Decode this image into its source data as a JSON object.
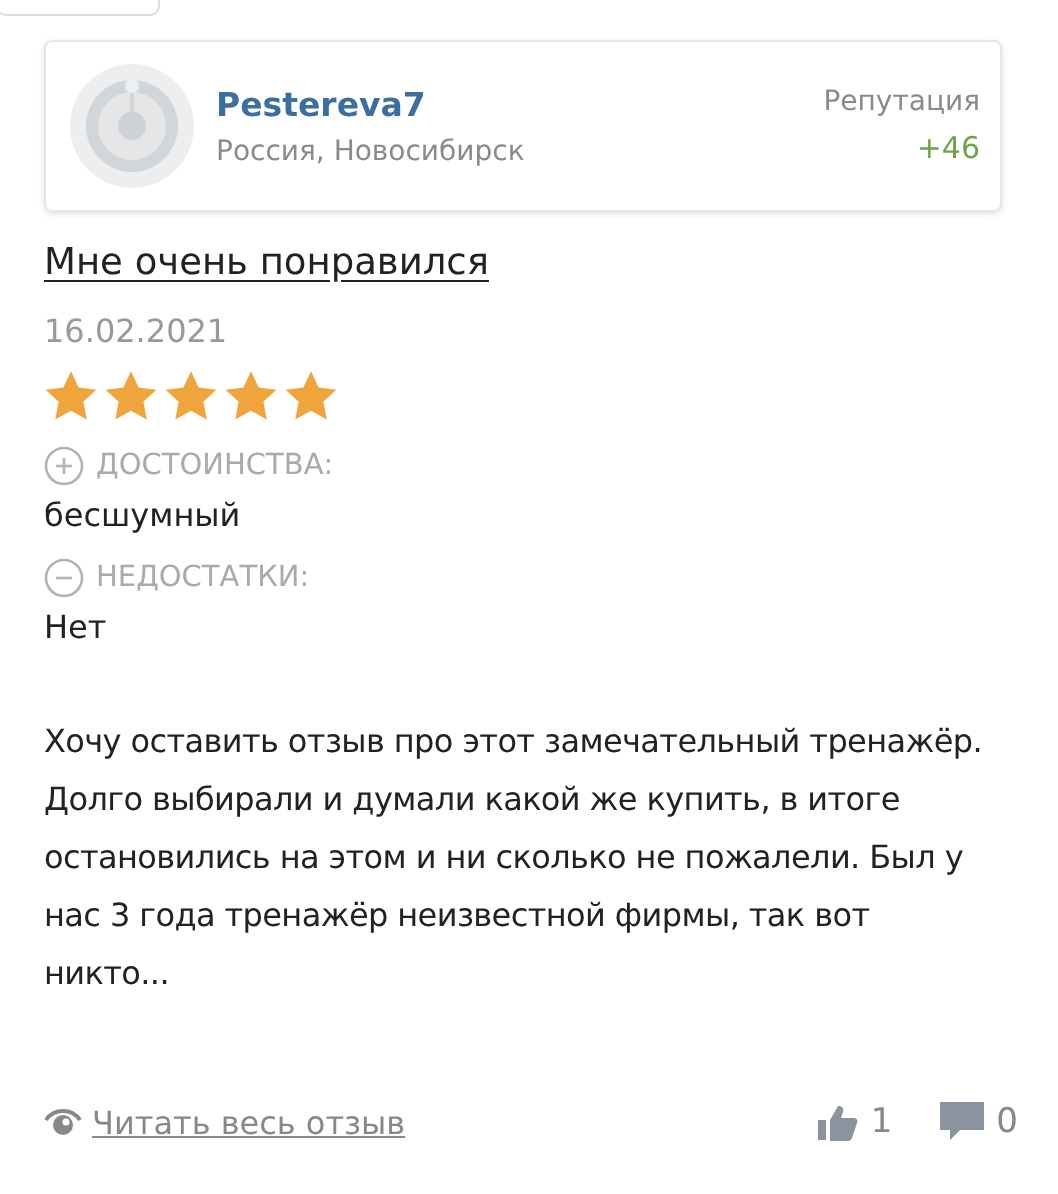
{
  "author": {
    "name": "Pestereva7",
    "location": "Россия, Новосибирск",
    "reputation_label": "Репутация",
    "reputation": "+46"
  },
  "review": {
    "title": "Мне очень понравился",
    "date": "16.02.2021",
    "stars": 5,
    "pros_label": "ДОСТОИНСТВА:",
    "pros": "бесшумный",
    "cons_label": "НЕДОСТАТКИ:",
    "cons": "Нет",
    "text": "Хочу оставить отзыв про этот замечательный тренажёр. Долго выбирали и думали какой же купить, в итоге остановились на этом и ни сколько не пожалели. Был у нас 3 года тренажёр неизвестной фирмы, так вот никто..."
  },
  "footer": {
    "read_link": "Читать весь отзыв",
    "likes": "1",
    "comments": "0"
  }
}
